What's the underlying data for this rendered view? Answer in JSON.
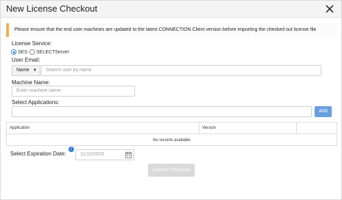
{
  "dialog": {
    "title": "New License Checkout"
  },
  "notice": "Please ensure that the end user machines are updated to the latest CONNECTION Client version before importing the checked out license file",
  "license_service": {
    "label": "License Service:",
    "options": [
      "SES",
      "SELECTServer"
    ],
    "selected": "SES"
  },
  "user_email": {
    "label": "User Email:",
    "dropdown_value": "Name",
    "placeholder": "Search user by name"
  },
  "machine_name": {
    "label": "Machine Name:",
    "placeholder": "Enter machine name"
  },
  "applications": {
    "label": "Select Applications:",
    "add_label": "Add",
    "columns": [
      "Application",
      "Version"
    ],
    "empty_text": "No records available"
  },
  "expiration": {
    "label": "Select Expiration Date:",
    "info_glyph": "i",
    "placeholder": "11/10/2023"
  },
  "checkout_label": "License Checkout",
  "colors": {
    "accent": "#2f7ed8",
    "notice_border": "#f0ad4e",
    "add_button": "#6b9ee0",
    "disabled_button": "#d9d9d9"
  }
}
